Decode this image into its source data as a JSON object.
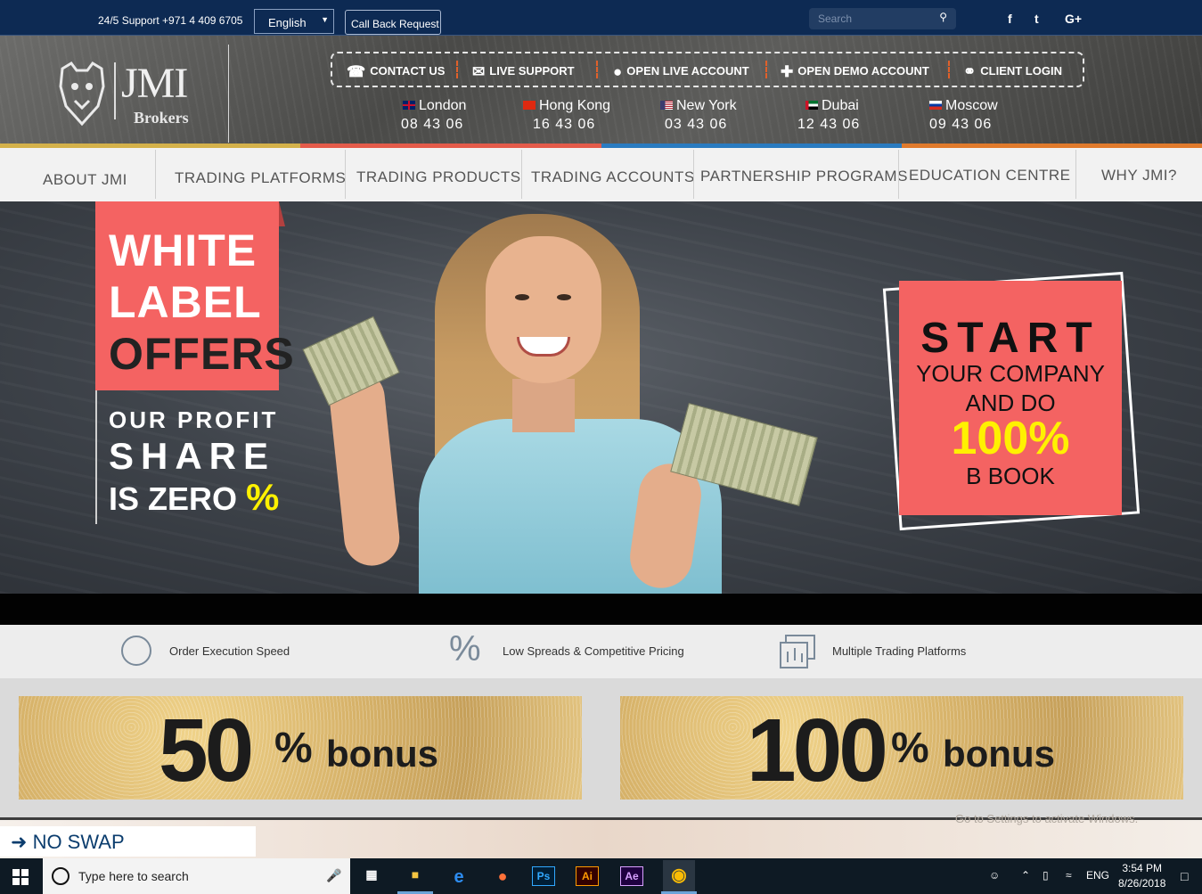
{
  "topbar": {
    "support": "24/5 Support +971 4 409 6705",
    "language": "English",
    "callback": "Call Back Request",
    "search_placeholder": "Search",
    "social": [
      "f",
      "t",
      "G+"
    ]
  },
  "logo": {
    "name": "JMI",
    "sub": "Brokers"
  },
  "quick_links": [
    {
      "label": "CONTACT US",
      "icon": "phone-icon"
    },
    {
      "label": "LIVE SUPPORT",
      "icon": "chat-icon"
    },
    {
      "label": "OPEN LIVE ACCOUNT",
      "icon": "user-icon"
    },
    {
      "label": "OPEN DEMO ACCOUNT",
      "icon": "user-add-icon"
    },
    {
      "label": "CLIENT LOGIN",
      "icon": "key-icon"
    }
  ],
  "clocks": [
    {
      "city": "London",
      "time": "08  43  06"
    },
    {
      "city": "Hong Kong",
      "time": "16  43  06"
    },
    {
      "city": "New York",
      "time": "03  43  06"
    },
    {
      "city": "Dubai",
      "time": "12  43  06"
    },
    {
      "city": "Moscow",
      "time": "09  43  06"
    }
  ],
  "nav": [
    "ABOUT JMI",
    "TRADING PLATFORMS",
    "TRADING  PRODUCTS",
    "TRADING ACCOUNTS",
    "PARTNERSHIP PROGRAMS",
    "EDUCATION  CENTRE",
    "WHY JMI?"
  ],
  "hero": {
    "left_title": [
      "WHITE",
      "LABEL",
      "OFFERS"
    ],
    "profit": [
      "OUR  PROFIT",
      "SHARE",
      "IS ZERO",
      "%"
    ],
    "right": [
      "START",
      "YOUR COMPANY",
      "AND DO",
      "100%",
      "B BOOK"
    ]
  },
  "features": [
    "Order Execution Speed",
    "Low Spreads & Competitive Pricing",
    "Multiple Trading Platforms"
  ],
  "bonuses": [
    {
      "num": "50",
      "pct": "%",
      "word": "bonus"
    },
    {
      "num": "100",
      "pct": "%",
      "word": "bonus"
    }
  ],
  "teaser": {
    "label": "NO SWAP",
    "watermark": "Go to Settings to activate Windows."
  },
  "taskbar": {
    "search_placeholder": "Type here to search",
    "lang": "ENG",
    "time": "3:54 PM",
    "date": "8/26/2018"
  },
  "colors": {
    "accent": "#f46362",
    "navy": "#0d2a53",
    "yellow": "#fff100"
  }
}
